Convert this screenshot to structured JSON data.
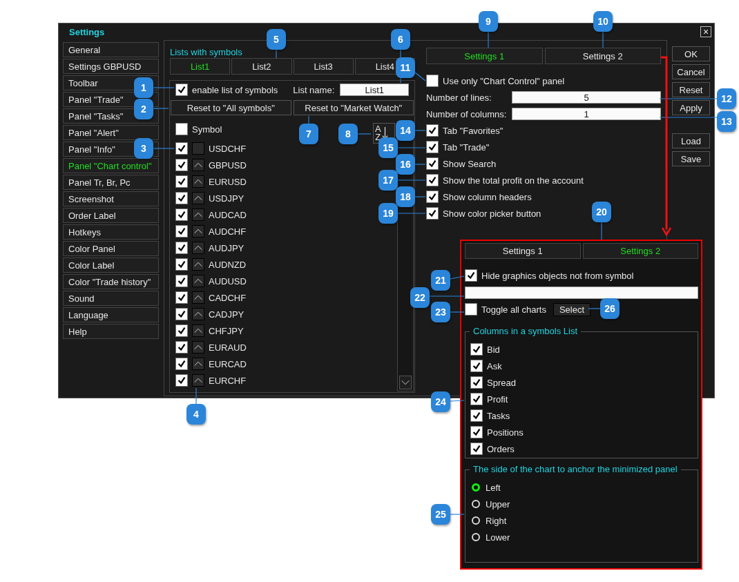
{
  "window": {
    "title": "Settings",
    "close": "×"
  },
  "sidebar": {
    "items": [
      {
        "label": "General",
        "selected": false
      },
      {
        "label": "Settings GBPUSD",
        "selected": false
      },
      {
        "label": "Toolbar",
        "selected": false
      },
      {
        "label": "Panel \"Trade\"",
        "selected": false
      },
      {
        "label": "Panel \"Tasks\"",
        "selected": false
      },
      {
        "label": "Panel \"Alert\"",
        "selected": false
      },
      {
        "label": "Panel \"Info\"",
        "selected": false
      },
      {
        "label": "Panel \"Chart control\"",
        "selected": true
      },
      {
        "label": "Panel Tr, Br, Pc",
        "selected": false
      },
      {
        "label": "Screenshot",
        "selected": false
      },
      {
        "label": "Order Label",
        "selected": false
      },
      {
        "label": "Hotkeys",
        "selected": false
      },
      {
        "label": "Color Panel",
        "selected": false
      },
      {
        "label": "Color Label",
        "selected": false
      },
      {
        "label": "Color \"Trade history\"",
        "selected": false
      },
      {
        "label": "Sound",
        "selected": false
      },
      {
        "label": "Language",
        "selected": false
      },
      {
        "label": "Help",
        "selected": false
      }
    ]
  },
  "symbol_lists": {
    "title": "Lists with symbols",
    "tabs": [
      {
        "label": "List1",
        "selected": true
      },
      {
        "label": "List2",
        "selected": false
      },
      {
        "label": "List3",
        "selected": false
      },
      {
        "label": "List4",
        "selected": false
      }
    ],
    "enable": {
      "label": "enable list of symbols",
      "checked": true
    },
    "list_name": {
      "label": "List name:",
      "value": "List1"
    },
    "buttons": [
      "Reset to \"All symbols\"",
      "Reset to \"Market Watch\""
    ],
    "header": {
      "label": "Symbol",
      "checked": false
    },
    "sort_button": {
      "top": "A",
      "bottom": "Z"
    },
    "rows": [
      {
        "symbol": "USDCHF",
        "checked": true,
        "movable": false
      },
      {
        "symbol": "GBPUSD",
        "checked": true,
        "movable": true
      },
      {
        "symbol": "EURUSD",
        "checked": true,
        "movable": true
      },
      {
        "symbol": "USDJPY",
        "checked": true,
        "movable": true
      },
      {
        "symbol": "AUDCAD",
        "checked": true,
        "movable": true
      },
      {
        "symbol": "AUDCHF",
        "checked": true,
        "movable": true
      },
      {
        "symbol": "AUDJPY",
        "checked": true,
        "movable": true
      },
      {
        "symbol": "AUDNZD",
        "checked": true,
        "movable": true
      },
      {
        "symbol": "AUDUSD",
        "checked": true,
        "movable": true
      },
      {
        "symbol": "CADCHF",
        "checked": true,
        "movable": true
      },
      {
        "symbol": "CADJPY",
        "checked": true,
        "movable": true
      },
      {
        "symbol": "CHFJPY",
        "checked": true,
        "movable": true
      },
      {
        "symbol": "EURAUD",
        "checked": true,
        "movable": true
      },
      {
        "symbol": "EURCAD",
        "checked": true,
        "movable": true
      },
      {
        "symbol": "EURCHF",
        "checked": true,
        "movable": true
      }
    ]
  },
  "settings_1": {
    "tabs": [
      {
        "label": "Settings 1",
        "selected": true
      },
      {
        "label": "Settings 2",
        "selected": false
      }
    ],
    "use_only": {
      "label": "Use only \"Chart Control\" panel",
      "checked": false
    },
    "fields": [
      {
        "label": "Number of lines:",
        "value": "5"
      },
      {
        "label": "Number of columns:",
        "value": "1"
      }
    ],
    "options": [
      {
        "label": "Tab \"Favorites\"",
        "checked": true
      },
      {
        "label": "Tab \"Trade\"",
        "checked": true
      },
      {
        "label": "Show Search",
        "checked": true
      },
      {
        "label": "Show the total profit on the account",
        "checked": true
      },
      {
        "label": "Show column headers",
        "checked": true
      },
      {
        "label": "Show color picker button",
        "checked": true
      }
    ]
  },
  "buttons": [
    [
      "OK",
      "Cancel",
      "Reset",
      "Apply"
    ],
    [
      "Load",
      "Save"
    ]
  ],
  "settings_2": {
    "tabs": [
      {
        "label": "Settings 1",
        "selected": false
      },
      {
        "label": "Settings 2",
        "selected": true
      }
    ],
    "hide_graphics": {
      "label": "Hide graphics objects not from symbol",
      "checked": true
    },
    "toggle_all": {
      "label": "Toggle all charts",
      "checked": false
    },
    "select_button": "Select",
    "columns_group": {
      "title": "Columns in a symbols List",
      "items": [
        {
          "label": "Bid",
          "checked": true
        },
        {
          "label": "Ask",
          "checked": true
        },
        {
          "label": "Spread",
          "checked": true
        },
        {
          "label": "Profit",
          "checked": true
        },
        {
          "label": "Tasks",
          "checked": true
        },
        {
          "label": "Positions",
          "checked": true
        },
        {
          "label": "Orders",
          "checked": true
        }
      ]
    },
    "anchor_group": {
      "title": "The side of the chart to anchor the minimized panel",
      "options": [
        {
          "label": "Left",
          "selected": true
        },
        {
          "label": "Upper",
          "selected": false
        },
        {
          "label": "Right",
          "selected": false
        },
        {
          "label": "Lower",
          "selected": false
        }
      ]
    }
  },
  "callouts": [
    {
      "number": "1"
    },
    {
      "number": "2"
    },
    {
      "number": "3"
    },
    {
      "number": "4"
    },
    {
      "number": "5"
    },
    {
      "number": "6"
    },
    {
      "number": "7"
    },
    {
      "number": "8"
    },
    {
      "number": "9"
    },
    {
      "number": "10"
    },
    {
      "number": "11"
    },
    {
      "number": "12"
    },
    {
      "number": "13"
    },
    {
      "number": "14"
    },
    {
      "number": "15"
    },
    {
      "number": "16"
    },
    {
      "number": "17"
    },
    {
      "number": "18"
    },
    {
      "number": "19"
    },
    {
      "number": "20"
    },
    {
      "number": "21"
    },
    {
      "number": "22"
    },
    {
      "number": "23"
    },
    {
      "number": "24"
    },
    {
      "number": "25"
    },
    {
      "number": "26"
    }
  ]
}
